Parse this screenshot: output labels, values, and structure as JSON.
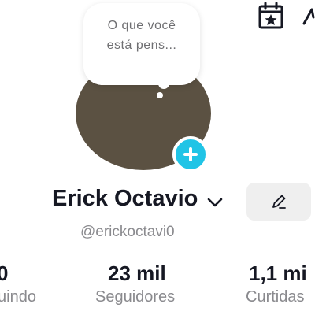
{
  "bubble": {
    "text": "O que você está pens..."
  },
  "profile": {
    "name": "Erick Octavio",
    "username": "@erickoctavi0"
  },
  "stats": [
    {
      "value": "0",
      "label": "uindo"
    },
    {
      "value": "23 mil",
      "label": "Seguidores"
    },
    {
      "value": "1,1 mi",
      "label": "Curtidas"
    }
  ],
  "colors": {
    "avatar": "#5b5142",
    "add_button": "#20c4e6",
    "text_primary": "#161823",
    "text_secondary": "#8a8a8e"
  },
  "icons": [
    "calendar-star-icon",
    "plus-icon",
    "chevron-down-icon",
    "pencil-icon"
  ]
}
